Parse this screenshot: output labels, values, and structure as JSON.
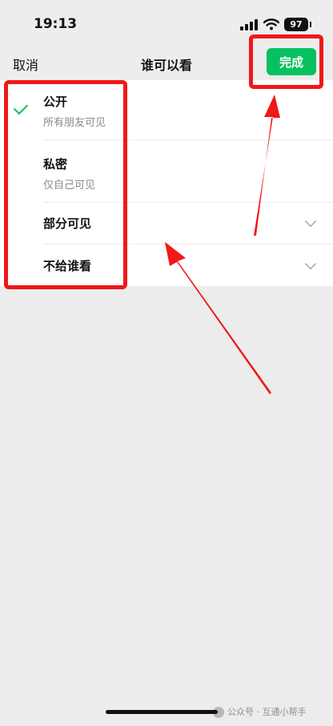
{
  "status_bar": {
    "time": "19:13",
    "battery": "97"
  },
  "header": {
    "cancel_label": "取消",
    "title": "谁可以看",
    "done_label": "完成"
  },
  "options": [
    {
      "title": "公开",
      "subtitle": "所有朋友可见",
      "selected": true
    },
    {
      "title": "私密",
      "subtitle": "仅自己可见"
    },
    {
      "title": "部分可见"
    },
    {
      "title": "不给谁看"
    }
  ],
  "watermark": {
    "text": "公众号 · 互通小帮手"
  },
  "colors": {
    "accent_green": "#07c160",
    "annotation_red": "#f01818"
  }
}
